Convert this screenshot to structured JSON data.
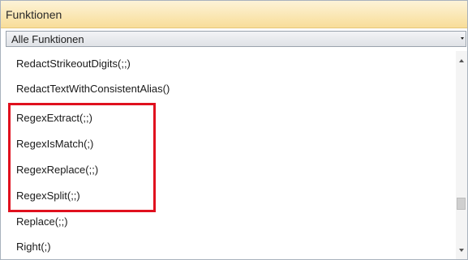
{
  "panel": {
    "title": "Funktionen"
  },
  "filter": {
    "selected": "Alle Funktionen"
  },
  "functions": [
    "RedactStrikeoutDigits(;;)",
    "RedactTextWithConsistentAlias()",
    "RegexExtract(;;)",
    "RegexIsMatch(;)",
    "RegexReplace(;;)",
    "RegexSplit(;;)",
    "Replace(;;)",
    "Right(;)"
  ],
  "highlight": {
    "color": "#e0101e",
    "items": [
      "RegexExtract(;;)",
      "RegexIsMatch(;)",
      "RegexReplace(;;)",
      "RegexSplit(;;)"
    ]
  },
  "colors": {
    "header_bg": "#fae6b1",
    "dropdown_bg": "#dfe2e6",
    "border": "#a9b2bd"
  }
}
